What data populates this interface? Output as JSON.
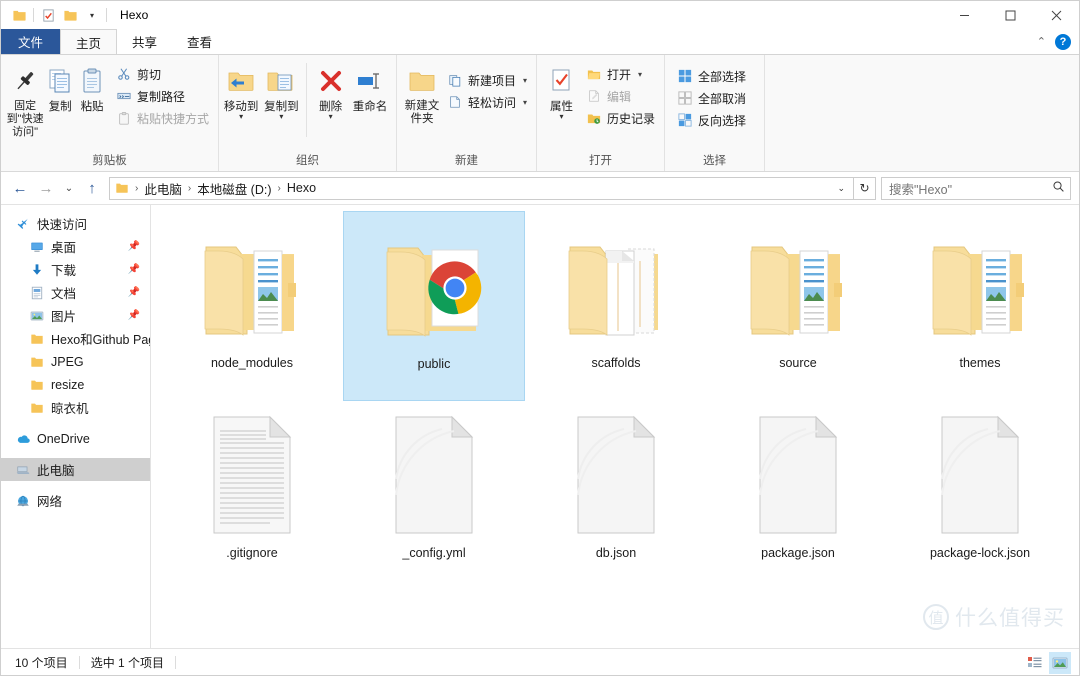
{
  "window": {
    "title": "Hexo",
    "quick_access": [
      {
        "name": "folder-icon",
        "label": "文件夹"
      },
      {
        "name": "properties-icon",
        "label": "属性"
      },
      {
        "name": "new-folder-icon",
        "label": "新建文件夹"
      }
    ],
    "qat_dropdown": "▾",
    "controls": {
      "minimize": "—",
      "maximize": "❐",
      "close": "✕"
    }
  },
  "tabs": [
    {
      "id": "file",
      "label": "文件"
    },
    {
      "id": "home",
      "label": "主页"
    },
    {
      "id": "share",
      "label": "共享"
    },
    {
      "id": "view",
      "label": "查看"
    }
  ],
  "ribbon_right": {
    "collapse": "⌃",
    "help": "?"
  },
  "ribbon": {
    "groups": [
      {
        "title": "剪贴板",
        "big": [
          {
            "label": "固定到\"快速访问\"",
            "icon": "pin-icon"
          },
          {
            "label": "复制",
            "icon": "copy-icon"
          },
          {
            "label": "粘贴",
            "icon": "paste-icon"
          }
        ],
        "small": [
          {
            "label": "剪切",
            "icon": "scissors-icon",
            "disabled": false
          },
          {
            "label": "复制路径",
            "icon": "copy-path-icon",
            "disabled": false
          },
          {
            "label": "粘贴快捷方式",
            "icon": "paste-shortcut-icon",
            "disabled": true
          }
        ]
      },
      {
        "title": "组织",
        "big": [
          {
            "label": "移动到",
            "icon": "move-to-icon",
            "has_caret": true
          },
          {
            "label": "复制到",
            "icon": "copy-to-icon",
            "has_caret": true
          },
          {
            "label": "删除",
            "icon": "delete-icon",
            "has_caret": true
          },
          {
            "label": "重命名",
            "icon": "rename-icon"
          }
        ],
        "small": []
      },
      {
        "title": "新建",
        "big": [
          {
            "label": "新建文件夹",
            "icon": "new-folder-icon"
          }
        ],
        "small": [
          {
            "label": "新建项目",
            "icon": "new-item-icon",
            "has_caret": true
          },
          {
            "label": "轻松访问",
            "icon": "easy-access-icon",
            "has_caret": true
          }
        ]
      },
      {
        "title": "打开",
        "big": [
          {
            "label": "属性",
            "icon": "properties-icon",
            "has_caret": true
          }
        ],
        "small": [
          {
            "label": "打开",
            "icon": "open-icon",
            "has_caret": true
          },
          {
            "label": "编辑",
            "icon": "edit-icon",
            "disabled": true
          },
          {
            "label": "历史记录",
            "icon": "history-icon"
          }
        ]
      },
      {
        "title": "选择",
        "big": [],
        "small": [
          {
            "label": "全部选择",
            "icon": "select-all-icon"
          },
          {
            "label": "全部取消",
            "icon": "select-none-icon",
            "disabled": false
          },
          {
            "label": "反向选择",
            "icon": "invert-selection-icon"
          }
        ]
      }
    ]
  },
  "address": {
    "back": "←",
    "forward": "→",
    "recent": "⌄",
    "up": "↑",
    "crumbs": [
      "此电脑",
      "本地磁盘 (D:)",
      "Hexo"
    ],
    "separator": "›",
    "dropdown": "⌄",
    "refresh": "↻"
  },
  "search": {
    "placeholder": "搜索\"Hexo\"",
    "icon": "search-icon"
  },
  "sidebar": {
    "items": [
      {
        "label": "快速访问",
        "icon": "star-icon",
        "indent": false,
        "pinned": false,
        "selected": false
      },
      {
        "label": "桌面",
        "icon": "desktop-icon",
        "indent": true,
        "pinned": true,
        "selected": false
      },
      {
        "label": "下载",
        "icon": "download-icon",
        "indent": true,
        "pinned": true,
        "selected": false
      },
      {
        "label": "文档",
        "icon": "document-icon",
        "indent": true,
        "pinned": true,
        "selected": false
      },
      {
        "label": "图片",
        "icon": "pictures-icon",
        "indent": true,
        "pinned": true,
        "selected": false
      },
      {
        "label": "Hexo和Github Pag",
        "icon": "folder-icon",
        "indent": true,
        "pinned": false,
        "selected": false
      },
      {
        "label": "JPEG",
        "icon": "folder-icon",
        "indent": true,
        "pinned": false,
        "selected": false
      },
      {
        "label": "resize",
        "icon": "folder-icon",
        "indent": true,
        "pinned": false,
        "selected": false
      },
      {
        "label": "晾衣机",
        "icon": "folder-icon",
        "indent": true,
        "pinned": false,
        "selected": false
      },
      {
        "label": "OneDrive",
        "icon": "onedrive-icon",
        "indent": false,
        "pinned": false,
        "selected": false,
        "gap_before": true
      },
      {
        "label": "此电脑",
        "icon": "this-pc-icon",
        "indent": false,
        "pinned": false,
        "selected": true,
        "gap_before": true
      },
      {
        "label": "网络",
        "icon": "network-icon",
        "indent": false,
        "pinned": false,
        "selected": false,
        "gap_before": true
      }
    ]
  },
  "files": [
    {
      "name": "node_modules",
      "type": "folder",
      "variant": "documents",
      "selected": false
    },
    {
      "name": "public",
      "type": "folder",
      "variant": "chrome",
      "selected": true
    },
    {
      "name": "scaffolds",
      "type": "folder",
      "variant": "blank-pages",
      "selected": false
    },
    {
      "name": "source",
      "type": "folder",
      "variant": "documents",
      "selected": false
    },
    {
      "name": "themes",
      "type": "folder",
      "variant": "documents",
      "selected": false
    },
    {
      "name": ".gitignore",
      "type": "file",
      "variant": "text-lines",
      "selected": false
    },
    {
      "name": "_config.yml",
      "type": "file",
      "variant": "blank",
      "selected": false
    },
    {
      "name": "db.json",
      "type": "file",
      "variant": "blank",
      "selected": false
    },
    {
      "name": "package.json",
      "type": "file",
      "variant": "blank",
      "selected": false
    },
    {
      "name": "package-lock.json",
      "type": "file",
      "variant": "blank",
      "selected": false
    }
  ],
  "status": {
    "item_count": "10 个项目",
    "selection": "选中 1 个项目",
    "views": [
      {
        "name": "details-view-button",
        "active": false
      },
      {
        "name": "large-icons-view-button",
        "active": true
      }
    ]
  },
  "watermark": {
    "mark": "值",
    "text": "什么值得买"
  },
  "colors": {
    "file_tab_blue": "#2b579a",
    "selection_blue": "#cce8f9",
    "nav_selected_gray": "#cfcfcf",
    "accent_blue": "#0078d7",
    "folder_yellow": "#fcdb8d"
  }
}
